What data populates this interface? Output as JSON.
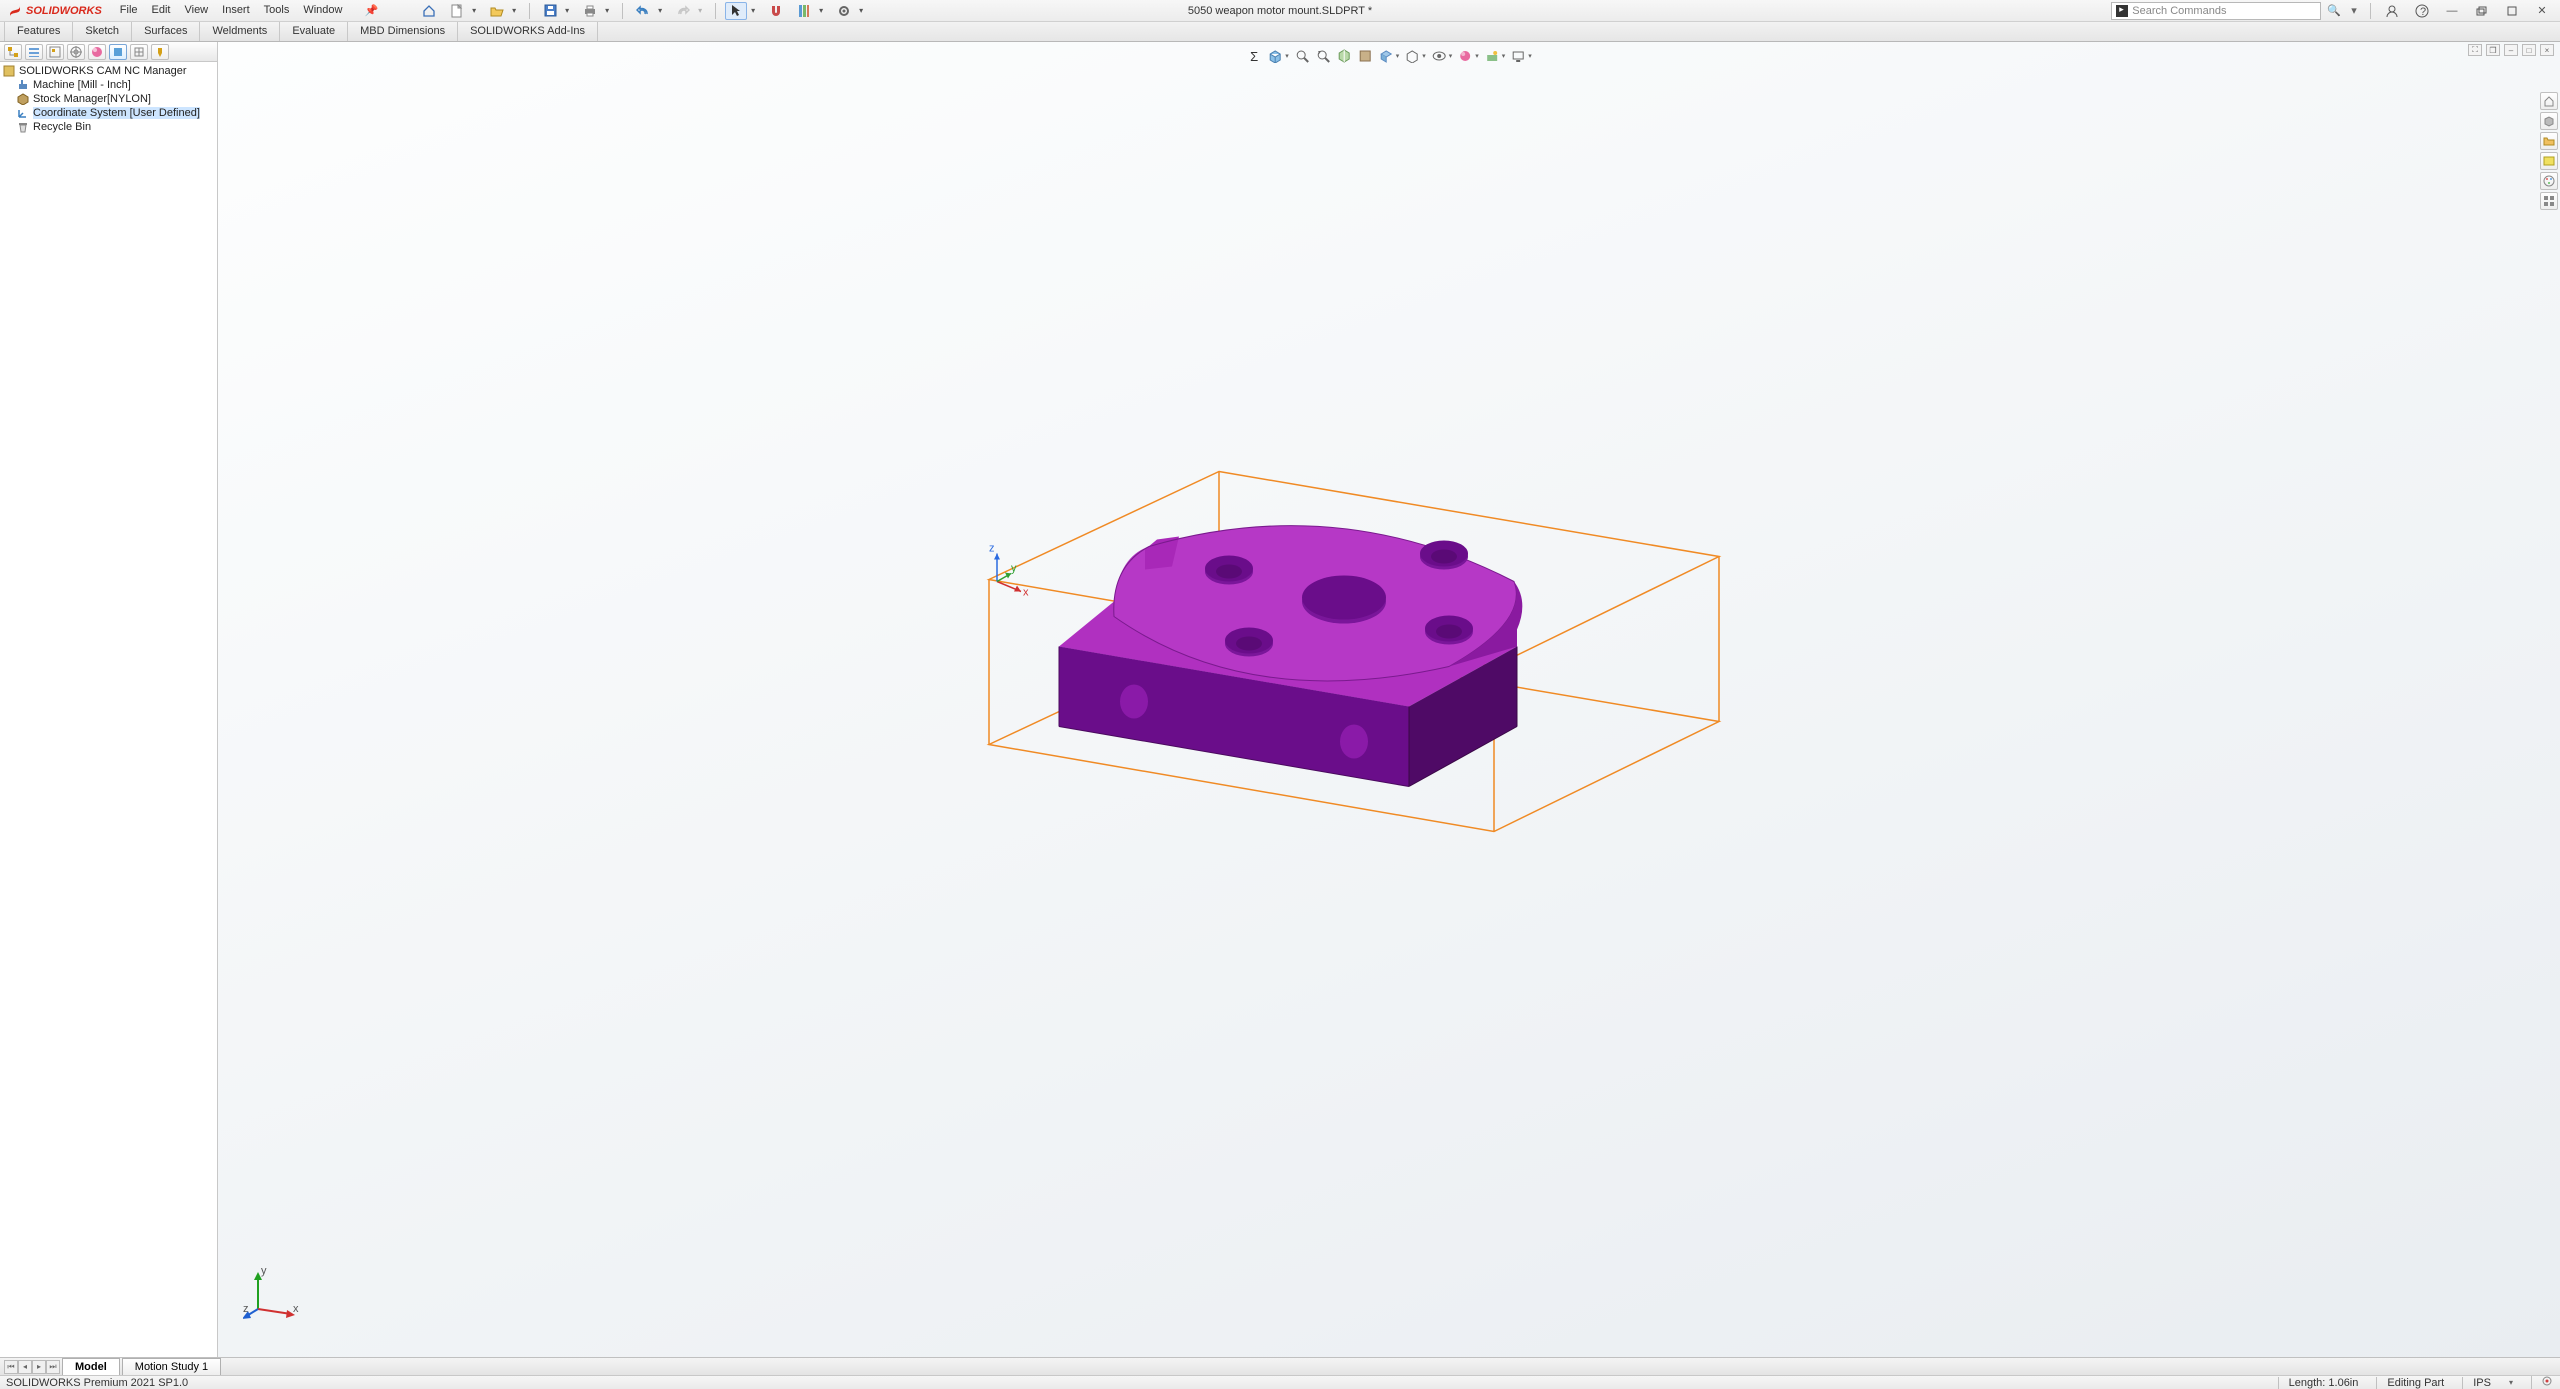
{
  "app": {
    "brand": "SOLIDWORKS",
    "doc_title": "5050 weapon motor mount.SLDPRT *"
  },
  "menu": [
    "File",
    "Edit",
    "View",
    "Insert",
    "Tools",
    "Window"
  ],
  "search": {
    "placeholder": "Search Commands"
  },
  "command_tabs": [
    "Features",
    "Sketch",
    "Surfaces",
    "Weldments",
    "Evaluate",
    "MBD Dimensions",
    "SOLIDWORKS Add-Ins"
  ],
  "feature_tree": {
    "root": "SOLIDWORKS CAM NC Manager",
    "items": [
      {
        "label": "Machine [Mill - Inch]",
        "icon": "machine"
      },
      {
        "label": "Stock Manager[NYLON]",
        "icon": "stock"
      },
      {
        "label": "Coordinate System [User Defined]",
        "icon": "csys",
        "selected": true
      },
      {
        "label": "Recycle Bin",
        "icon": "recycle"
      }
    ]
  },
  "doc_tabs": {
    "active": "Model",
    "other": "Motion Study 1"
  },
  "status": {
    "left": "SOLIDWORKS Premium 2021 SP1.0",
    "length": "Length: 1.06in",
    "mode": "Editing Part",
    "units": "IPS"
  },
  "colors": {
    "part_top": "#b030c0",
    "part_front": "#6a0d8a",
    "part_side": "#4f0a66",
    "stock": "#f08a24"
  }
}
